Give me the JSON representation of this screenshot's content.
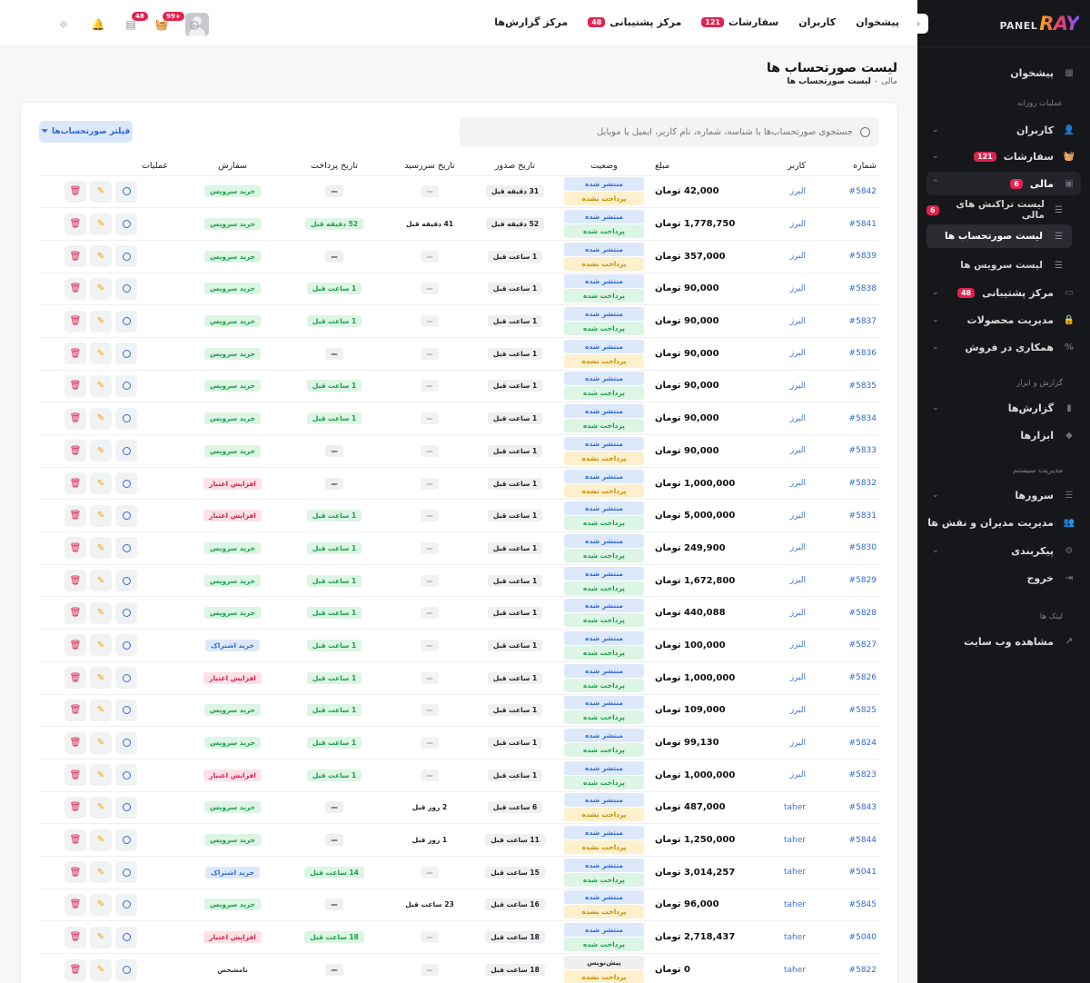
{
  "sidebar": {
    "logo_main": "RAY",
    "logo_sub": "PANEL",
    "items": [
      {
        "label": "پیشخوان"
      },
      {
        "label": "کاربران"
      },
      {
        "label": "سفارشات",
        "badge": "121"
      },
      {
        "label": "مالی",
        "badge": "6"
      },
      {
        "label": "مرکز پشتیبانی",
        "badge": "48"
      },
      {
        "label": "مدیریت محصولات"
      },
      {
        "label": "همکاری در فروش"
      },
      {
        "label": "گزارش‌ها"
      },
      {
        "label": "ابزارها"
      },
      {
        "label": "سرورها"
      },
      {
        "label": "مدیریت مدیران و نقش ها"
      },
      {
        "label": "پیکربندی"
      },
      {
        "label": "خروج"
      },
      {
        "label": "مشاهده وب سایت"
      }
    ],
    "sub_items": [
      {
        "label": "لیست تراکنش های مالی",
        "badge": "6"
      },
      {
        "label": "لیست صورتحساب ها"
      },
      {
        "label": "لیست سرویس ها"
      }
    ],
    "sections": [
      "عملیات روزانه",
      "گزارش و ابزار",
      "مدیریت سیستم",
      "لینک ها"
    ]
  },
  "topbar": {
    "nav": [
      {
        "label": "پیشخوان"
      },
      {
        "label": "کاربران"
      },
      {
        "label": "سفارشات",
        "badge": "121"
      },
      {
        "label": "مرکز پشتیبانی",
        "badge": "48"
      },
      {
        "label": "مرکز گزارش‌ها"
      }
    ],
    "cart_badge": "+99",
    "messages_badge": "48"
  },
  "page": {
    "title": "لیست صورتحساب ها",
    "breadcrumb_parent": "مالی",
    "breadcrumb_sep": "-",
    "breadcrumb_current": "لیست صورتحساب ها"
  },
  "toolbar": {
    "search_placeholder": "جستجوی صورتحساب‌ها با شناسه، شماره، نام کاربر، ایمیل یا موبایل",
    "filter_label": "فیلتر صورتحساب‌ها"
  },
  "table": {
    "headers": [
      "شماره",
      "کاربر",
      "مبلغ",
      "وضعیت",
      "تاریخ صدور",
      "تاریخ سررسید",
      "تاریخ پرداخت",
      "سفارش",
      "عملیات"
    ],
    "rows": [
      {
        "num": "#5842",
        "user": "البرز",
        "amount": "42,000 تومان",
        "status1": "منتشر شده",
        "status2": "پرداخت نشده",
        "s1c": "blue",
        "s2c": "yellow",
        "issued": "31 دقیقه قبل",
        "due": "—",
        "paid": "—",
        "order": "خرید سرویس",
        "oc": "green"
      },
      {
        "num": "#5841",
        "user": "البرز",
        "amount": "1,778,750 تومان",
        "status1": "منتشر شده",
        "status2": "پرداخت شده",
        "s1c": "blue",
        "s2c": "green",
        "issued": "52 دقیقه قبل",
        "due": "41 دقیقه قبل",
        "paid": "52 دقیقه قبل",
        "order": "خرید سرویس",
        "oc": "green"
      },
      {
        "num": "#5839",
        "user": "البرز",
        "amount": "357,000 تومان",
        "status1": "منتشر شده",
        "status2": "پرداخت نشده",
        "s1c": "blue",
        "s2c": "yellow",
        "issued": "1 ساعت قبل",
        "due": "—",
        "paid": "—",
        "order": "خرید سرویس",
        "oc": "green"
      },
      {
        "num": "#5838",
        "user": "البرز",
        "amount": "90,000 تومان",
        "status1": "منتشر شده",
        "status2": "پرداخت شده",
        "s1c": "blue",
        "s2c": "green",
        "issued": "1 ساعت قبل",
        "due": "—",
        "paid": "1 ساعت قبل",
        "order": "خرید سرویس",
        "oc": "green"
      },
      {
        "num": "#5837",
        "user": "البرز",
        "amount": "90,000 تومان",
        "status1": "منتشر شده",
        "status2": "پرداخت شده",
        "s1c": "blue",
        "s2c": "green",
        "issued": "1 ساعت قبل",
        "due": "—",
        "paid": "1 ساعت قبل",
        "order": "خرید سرویس",
        "oc": "green"
      },
      {
        "num": "#5836",
        "user": "البرز",
        "amount": "90,000 تومان",
        "status1": "منتشر شده",
        "status2": "پرداخت نشده",
        "s1c": "blue",
        "s2c": "yellow",
        "issued": "1 ساعت قبل",
        "due": "—",
        "paid": "—",
        "order": "خرید سرویس",
        "oc": "green"
      },
      {
        "num": "#5835",
        "user": "البرز",
        "amount": "90,000 تومان",
        "status1": "منتشر شده",
        "status2": "پرداخت شده",
        "s1c": "blue",
        "s2c": "green",
        "issued": "1 ساعت قبل",
        "due": "—",
        "paid": "1 ساعت قبل",
        "order": "خرید سرویس",
        "oc": "green"
      },
      {
        "num": "#5834",
        "user": "البرز",
        "amount": "90,000 تومان",
        "status1": "منتشر شده",
        "status2": "پرداخت شده",
        "s1c": "blue",
        "s2c": "green",
        "issued": "1 ساعت قبل",
        "due": "—",
        "paid": "1 ساعت قبل",
        "order": "خرید سرویس",
        "oc": "green"
      },
      {
        "num": "#5833",
        "user": "البرز",
        "amount": "90,000 تومان",
        "status1": "منتشر شده",
        "status2": "پرداخت نشده",
        "s1c": "blue",
        "s2c": "yellow",
        "issued": "1 ساعت قبل",
        "due": "—",
        "paid": "—",
        "order": "خرید سرویس",
        "oc": "green"
      },
      {
        "num": "#5832",
        "user": "البرز",
        "amount": "1,000,000 تومان",
        "status1": "منتشر شده",
        "status2": "پرداخت نشده",
        "s1c": "blue",
        "s2c": "yellow",
        "issued": "1 ساعت قبل",
        "due": "—",
        "paid": "—",
        "order": "افزایش اعتبار",
        "oc": "red"
      },
      {
        "num": "#5831",
        "user": "البرز",
        "amount": "5,000,000 تومان",
        "status1": "منتشر شده",
        "status2": "پرداخت شده",
        "s1c": "blue",
        "s2c": "green",
        "issued": "1 ساعت قبل",
        "due": "—",
        "paid": "1 ساعت قبل",
        "order": "افزایش اعتبار",
        "oc": "red"
      },
      {
        "num": "#5830",
        "user": "البرز",
        "amount": "249,900 تومان",
        "status1": "منتشر شده",
        "status2": "پرداخت شده",
        "s1c": "blue",
        "s2c": "green",
        "issued": "1 ساعت قبل",
        "due": "—",
        "paid": "1 ساعت قبل",
        "order": "خرید سرویس",
        "oc": "green"
      },
      {
        "num": "#5829",
        "user": "البرز",
        "amount": "1,672,800 تومان",
        "status1": "منتشر شده",
        "status2": "پرداخت شده",
        "s1c": "blue",
        "s2c": "green",
        "issued": "1 ساعت قبل",
        "due": "—",
        "paid": "1 ساعت قبل",
        "order": "خرید سرویس",
        "oc": "green"
      },
      {
        "num": "#5828",
        "user": "البرز",
        "amount": "440,088 تومان",
        "status1": "منتشر شده",
        "status2": "پرداخت شده",
        "s1c": "blue",
        "s2c": "green",
        "issued": "1 ساعت قبل",
        "due": "—",
        "paid": "1 ساعت قبل",
        "order": "خرید سرویس",
        "oc": "green"
      },
      {
        "num": "#5827",
        "user": "البرز",
        "amount": "100,000 تومان",
        "status1": "منتشر شده",
        "status2": "پرداخت شده",
        "s1c": "blue",
        "s2c": "green",
        "issued": "1 ساعت قبل",
        "due": "—",
        "paid": "1 ساعت قبل",
        "order": "خرید اشتراک",
        "oc": "blue"
      },
      {
        "num": "#5826",
        "user": "البرز",
        "amount": "1,000,000 تومان",
        "status1": "منتشر شده",
        "status2": "پرداخت شده",
        "s1c": "blue",
        "s2c": "green",
        "issued": "1 ساعت قبل",
        "due": "—",
        "paid": "1 ساعت قبل",
        "order": "افزایش اعتبار",
        "oc": "red"
      },
      {
        "num": "#5825",
        "user": "البرز",
        "amount": "109,000 تومان",
        "status1": "منتشر شده",
        "status2": "پرداخت شده",
        "s1c": "blue",
        "s2c": "green",
        "issued": "1 ساعت قبل",
        "due": "—",
        "paid": "1 ساعت قبل",
        "order": "خرید سرویس",
        "oc": "green"
      },
      {
        "num": "#5824",
        "user": "البرز",
        "amount": "99,130 تومان",
        "status1": "منتشر شده",
        "status2": "پرداخت شده",
        "s1c": "blue",
        "s2c": "green",
        "issued": "1 ساعت قبل",
        "due": "—",
        "paid": "1 ساعت قبل",
        "order": "خرید سرویس",
        "oc": "green"
      },
      {
        "num": "#5823",
        "user": "البرز",
        "amount": "1,000,000 تومان",
        "status1": "منتشر شده",
        "status2": "پرداخت شده",
        "s1c": "blue",
        "s2c": "green",
        "issued": "1 ساعت قبل",
        "due": "—",
        "paid": "1 ساعت قبل",
        "order": "افزایش اعتبار",
        "oc": "red"
      },
      {
        "num": "#5843",
        "user": "taher",
        "amount": "487,000 تومان",
        "status1": "منتشر شده",
        "status2": "پرداخت نشده",
        "s1c": "blue",
        "s2c": "yellow",
        "issued": "6 ساعت قبل",
        "due": "2 روز قبل",
        "paid": "—",
        "order": "خرید سرویس",
        "oc": "green"
      },
      {
        "num": "#5844",
        "user": "taher",
        "amount": "1,250,000 تومان",
        "status1": "منتشر شده",
        "status2": "پرداخت نشده",
        "s1c": "blue",
        "s2c": "yellow",
        "issued": "11 ساعت قبل",
        "due": "1 روز قبل",
        "paid": "—",
        "order": "خرید سرویس",
        "oc": "green"
      },
      {
        "num": "#5041",
        "user": "taher",
        "amount": "3,014,257 تومان",
        "status1": "منتشر شده",
        "status2": "پرداخت شده",
        "s1c": "blue",
        "s2c": "green",
        "issued": "15 ساعت قبل",
        "due": "—",
        "paid": "14 ساعت قبل",
        "order": "خرید اشتراک",
        "oc": "blue"
      },
      {
        "num": "#5845",
        "user": "taher",
        "amount": "96,000 تومان",
        "status1": "منتشر شده",
        "status2": "پرداخت نشده",
        "s1c": "blue",
        "s2c": "yellow",
        "issued": "16 ساعت قبل",
        "due": "23 ساعت قبل",
        "paid": "—",
        "order": "خرید سرویس",
        "oc": "green"
      },
      {
        "num": "#5040",
        "user": "taher",
        "amount": "2,718,437 تومان",
        "status1": "منتشر شده",
        "status2": "پرداخت شده",
        "s1c": "blue",
        "s2c": "green",
        "issued": "18 ساعت قبل",
        "due": "—",
        "paid": "18 ساعت قبل",
        "order": "افزایش اعتبار",
        "oc": "red"
      },
      {
        "num": "#5822",
        "user": "taher",
        "amount": "0 تومان",
        "status1": "پیش‌نویس",
        "status2": "پرداخت نشده",
        "s1c": "gray",
        "s2c": "yellow",
        "issued": "18 ساعت قبل",
        "due": "—",
        "paid": "—",
        "order": "نامشخص",
        "oc": "plain"
      }
    ]
  }
}
